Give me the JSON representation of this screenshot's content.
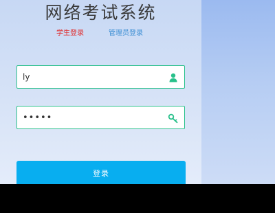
{
  "title": "网络考试系统",
  "tabs": [
    {
      "label": "学生登录",
      "active": true
    },
    {
      "label": "管理员登录",
      "active": false
    }
  ],
  "username": {
    "value": "ly",
    "icon": "user-icon"
  },
  "password": {
    "value": "•••••",
    "icon": "key-icon"
  },
  "login_label": "登录",
  "colors": {
    "accent": "#08aef0",
    "field_border": "#28c08a",
    "active_tab": "#e02a2a",
    "inactive_tab": "#3d8fd4"
  }
}
